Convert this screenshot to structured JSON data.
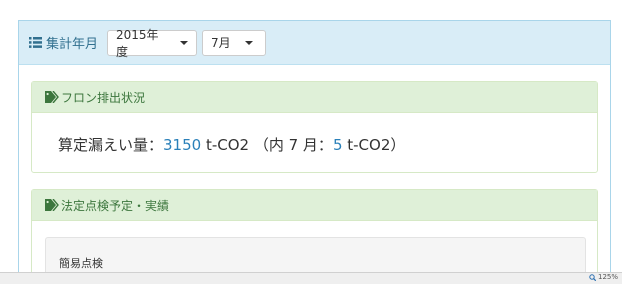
{
  "header": {
    "icon": "list-icon",
    "title": "集計年月",
    "year_select": {
      "value": "2015年度",
      "icon": "caret-down-icon"
    },
    "month_select": {
      "value": "7月",
      "icon": "caret-down-icon"
    }
  },
  "freon_panel": {
    "icon": "tag-icon",
    "title": "フロン排出状況",
    "label": "算定漏えい量：",
    "total_value": "3150",
    "unit": " t-CO2 （内 7 月：",
    "month_value": "5",
    "unit_end": " t-CO2）"
  },
  "inspection_panel": {
    "icon": "tag-icon",
    "title": "法定点検予定・実績",
    "sub_label": "簡易点検"
  },
  "statusbar": {
    "zoom": "125%",
    "icon": "zoom-icon"
  },
  "colors": {
    "header_bg": "#d9edf7",
    "header_text": "#31708f",
    "panel_head_bg": "#dff0d8",
    "panel_head_text": "#3c763d",
    "number": "#2a80b9"
  }
}
